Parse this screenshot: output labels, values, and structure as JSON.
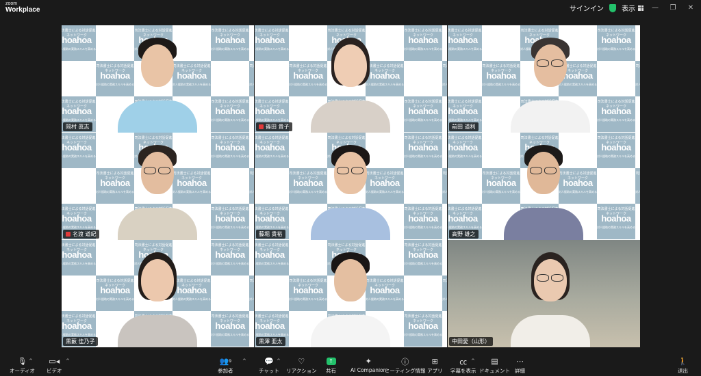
{
  "app": {
    "brand_top": "zoom",
    "brand_bottom": "Workplace"
  },
  "titlebar": {
    "signin": "サインイン",
    "view": "表示"
  },
  "backdrop": {
    "line1": "司法書士による",
    "line2": "対話促進ネットワーク",
    "logo": "hoahoa",
    "line3": "対人援助の実務スキルを高める",
    "line4": "ADRトレーニングを主催",
    "colors": {
      "blue": "#a8bfcc",
      "white": "#ffffff"
    }
  },
  "participants": [
    {
      "name": "岡村 眞志",
      "muted": false
    },
    {
      "name": "篠田 貴子",
      "muted": true
    },
    {
      "name": "前田 道利",
      "muted": false
    },
    {
      "name": "名渡 道紀",
      "muted": true
    },
    {
      "name": "藤堀 貴裕",
      "muted": false
    },
    {
      "name": "高野 雄之",
      "muted": false,
      "active": true
    },
    {
      "name": "黒藪 佳乃子",
      "muted": false
    },
    {
      "name": "黒澤 亜太",
      "muted": false
    },
    {
      "name": "中田愛（山形）",
      "muted": false
    }
  ],
  "toolbar": {
    "audio": "オーディオ",
    "video": "ビデオ",
    "participants": "参加者",
    "participants_count": "9",
    "chat": "チャット",
    "reactions": "リアクション",
    "share": "共有",
    "ai_companion": "AI Companion",
    "meeting_info": "ミーティング情報",
    "apps": "アプリ",
    "captions": "字幕を表示",
    "docs": "ドキュメント",
    "more": "詳細",
    "leave": "退出",
    "accent": "#23c16b",
    "danger": "#e03a3a"
  }
}
